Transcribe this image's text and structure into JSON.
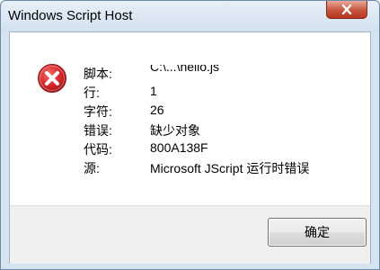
{
  "window": {
    "title": "Windows Script Host"
  },
  "icon": {
    "name": "error-icon",
    "color": "#c8202a"
  },
  "details": [
    {
      "label": "脚本:",
      "value": "C:\\...\\hello.js"
    },
    {
      "label": "行:",
      "value": "1"
    },
    {
      "label": "字符:",
      "value": "26"
    },
    {
      "label": "错误:",
      "value": "缺少对象"
    },
    {
      "label": "代码:",
      "value": "800A138F"
    },
    {
      "label": "源:",
      "value": "Microsoft JScript 运行时错误"
    }
  ],
  "buttons": {
    "ok_label": "确定"
  },
  "colors": {
    "titlebar": "#d6e4f1",
    "close_button": "#c7553f",
    "footer": "#f0f0f0"
  }
}
